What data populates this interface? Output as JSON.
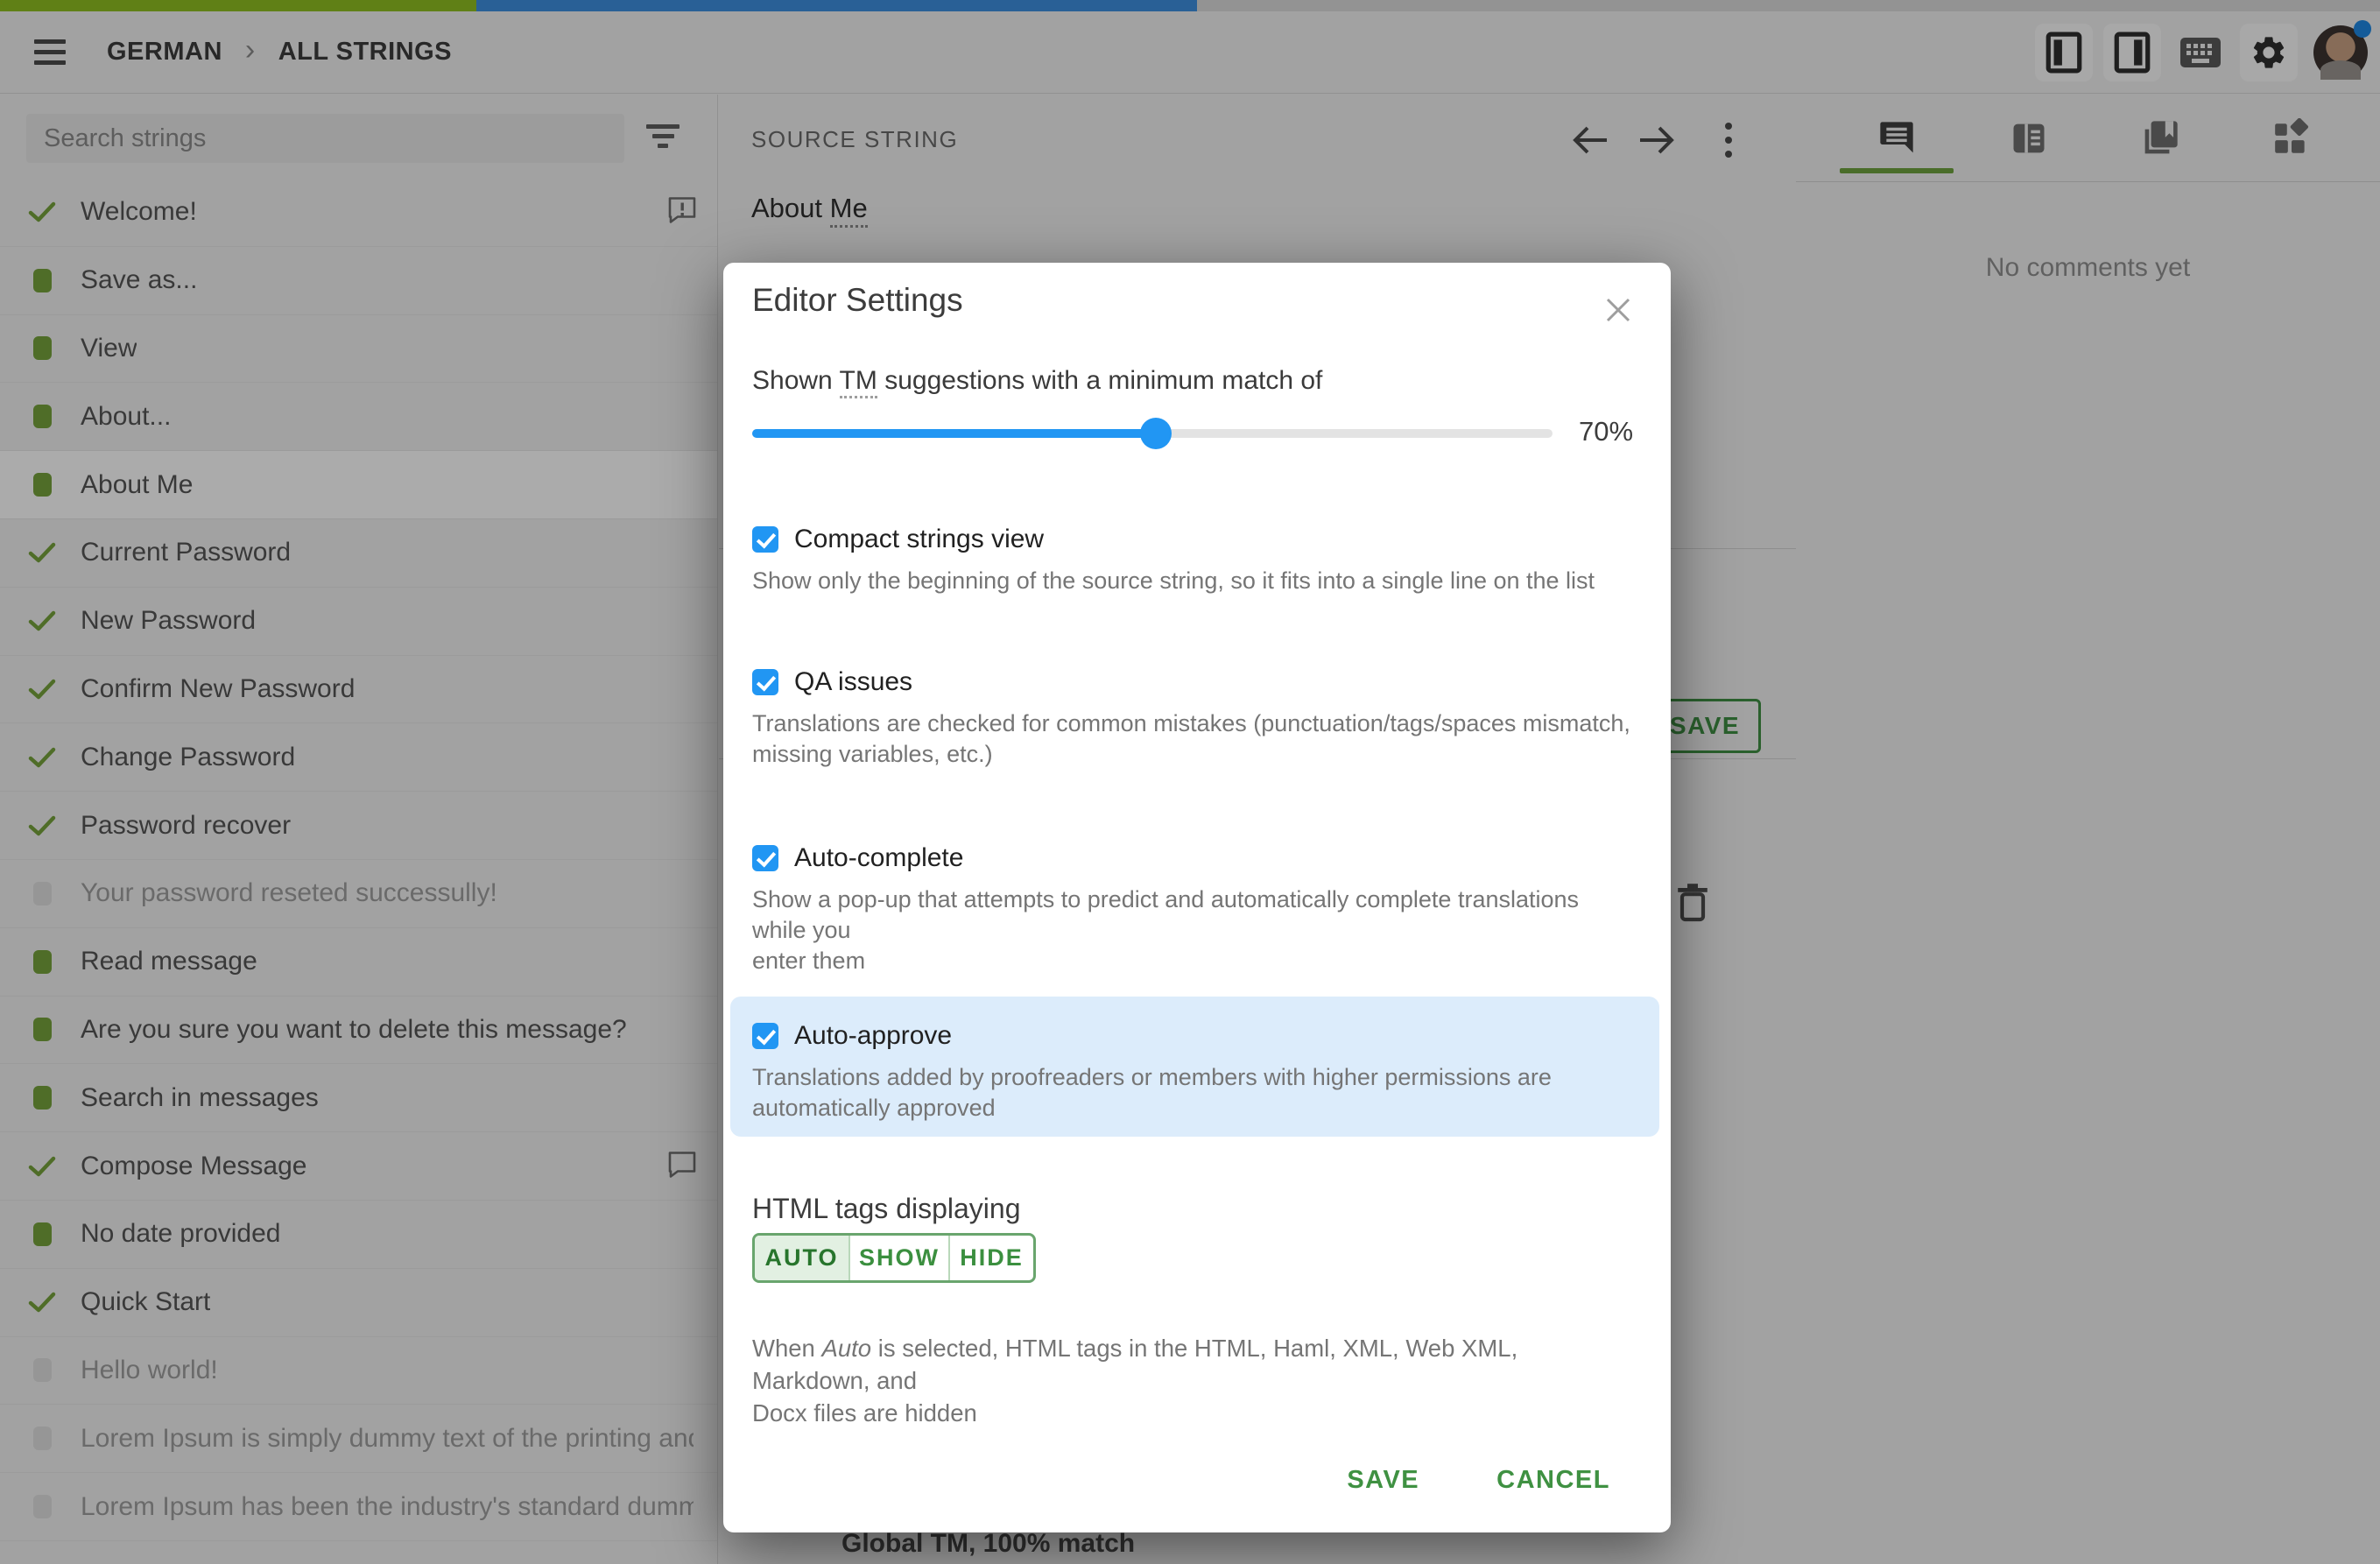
{
  "colors": {
    "progress_approved": "#8fbf21",
    "progress_translated": "#3e8fe0",
    "progress_rest": "#dcdcdc",
    "status_green": "#76a33c",
    "status_gray": "#e0e0e0",
    "checkbox_blue": "#2196f3",
    "slider_blue": "#2196f3",
    "highlight_blue": "#dcecfb",
    "accent_green": "#3f9142",
    "tab_underline": "#6fa33f",
    "auto_selected_bg": "#e2f0e2"
  },
  "progress": {
    "approved_pct": 20.0,
    "translated_pct": 30.3
  },
  "header": {
    "breadcrumb": [
      "GERMAN",
      "ALL STRINGS"
    ],
    "icons": [
      "menu-icon",
      "left-panel-icon",
      "right-panel-icon",
      "keyboard-icon",
      "gear-icon",
      "avatar"
    ]
  },
  "sidebar": {
    "search_placeholder": "Search strings",
    "items": [
      {
        "label": "Welcome!",
        "status": "approved",
        "comment": "alert"
      },
      {
        "label": "Save as...",
        "status": "translated"
      },
      {
        "label": "View",
        "status": "translated"
      },
      {
        "label": "About...",
        "status": "translated"
      },
      {
        "label": "About Me",
        "status": "translated",
        "selected": true
      },
      {
        "label": "Current Password",
        "status": "approved"
      },
      {
        "label": "New Password",
        "status": "approved"
      },
      {
        "label": "Confirm New Password",
        "status": "approved"
      },
      {
        "label": "Change Password",
        "status": "approved"
      },
      {
        "label": "Password recover",
        "status": "approved"
      },
      {
        "label": "Your password reseted successully!",
        "status": "untranslated"
      },
      {
        "label": "Read message",
        "status": "translated"
      },
      {
        "label": "Are you sure you want to delete this message?",
        "status": "translated"
      },
      {
        "label": "Search in messages",
        "status": "translated"
      },
      {
        "label": "Compose Message",
        "status": "approved",
        "comment": "plain"
      },
      {
        "label": "No date provided",
        "status": "translated"
      },
      {
        "label": "Quick Start",
        "status": "approved"
      },
      {
        "label": "Hello world!",
        "status": "untranslated"
      },
      {
        "label": "Lorem Ipsum is simply dummy text of the printing and ty…",
        "status": "untranslated"
      },
      {
        "label": "Lorem Ipsum has been the industry's standard dummy t…",
        "status": "untranslated"
      }
    ]
  },
  "source_panel": {
    "header": "SOURCE STRING",
    "source_prefix": "About ",
    "source_term": "Me",
    "save_label": "SAVE",
    "tm_suggestion": "Global TM, 100% match"
  },
  "comments_panel": {
    "empty_message": "No comments yet"
  },
  "modal": {
    "title": "Editor Settings",
    "tm_line": {
      "before": "Shown ",
      "term": "TM",
      "after": " suggestions with a minimum match of"
    },
    "slider": {
      "value": "70%",
      "fill_pct": 50.4
    },
    "options": [
      {
        "label": "Compact strings view",
        "desc": "Show only the beginning of the source string, so it fits into a single line on the list",
        "checked": true
      },
      {
        "label": "QA issues",
        "desc": "Translations are checked for common mistakes (punctuation/tags/spaces mismatch,\nmissing variables, etc.)",
        "checked": true
      },
      {
        "label": "Auto-complete",
        "desc": "Show a pop-up that attempts to predict and automatically complete translations while you\nenter them",
        "checked": true
      },
      {
        "label": "Auto-approve",
        "desc": "Translations added by proofreaders or members with higher permissions are\nautomatically approved",
        "checked": true,
        "highlighted": true
      }
    ],
    "html_tags": {
      "label": "HTML tags displaying",
      "options": [
        "AUTO",
        "SHOW",
        "HIDE"
      ],
      "selected": "AUTO",
      "desc": {
        "before": "When ",
        "italic": "Auto",
        "after": " is selected, HTML tags in the HTML, Haml, XML, Web XML, Markdown, and\nDocx files are hidden"
      }
    },
    "actions": {
      "save": "SAVE",
      "cancel": "CANCEL"
    }
  }
}
